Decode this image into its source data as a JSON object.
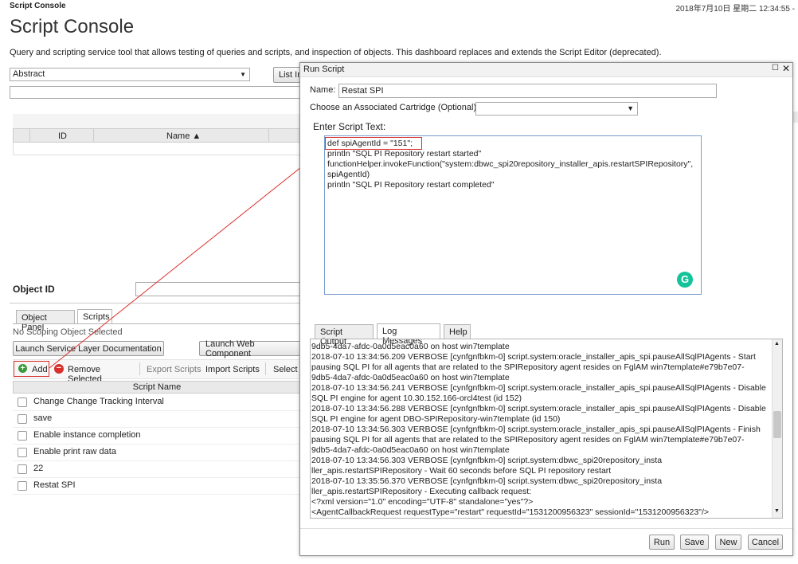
{
  "header": {
    "app_name": "Script Console",
    "datetime": "2018年7月10日 星期二 12:34:55 -",
    "page_title": "Script Console",
    "description": "Query and scripting service tool that allows testing of queries and scripts, and inspection of objects. This dashboard replaces and extends the Script Editor (deprecated)."
  },
  "query": {
    "type_select": "Abstract",
    "list_button": "List In"
  },
  "grid": {
    "col_id": "ID",
    "col_name": "Name ▲"
  },
  "object_id_label": "Object ID",
  "tabs": {
    "object_panel": "Object Panel",
    "scripts": "Scripts"
  },
  "no_scope": "No Scoping Object Selected",
  "buttons": {
    "launch_sl_doc": "Launch Service Layer Documentation",
    "launch_web": "Launch Web Component",
    "add": "Add",
    "remove": "Remove Selected",
    "export": "Export Scripts",
    "import": "Import Scripts",
    "select": "Select A"
  },
  "scripts": {
    "header": "Script Name",
    "items": [
      "Change Change Tracking Interval",
      "save",
      "Enable instance completion",
      "Enable print raw data",
      "22",
      "Restat SPI"
    ]
  },
  "dialog": {
    "title": "Run Script",
    "name_label": "Name:",
    "name_value": "Restat SPI",
    "cartridge_label": "Choose an Associated Cartridge (Optional):",
    "cartridge_value": "",
    "script_label": "Enter Script Text:",
    "script_lines": [
      "def spiAgentId = \"151\";",
      "println \"SQL PI Repository restart started\"",
      "functionHelper.invokeFunction(\"system:dbwc_spi20repository_installer_apis.restartSPIRepository\",",
      "spiAgentId)",
      "println \"SQL PI Repository restart completed\""
    ],
    "tabs": {
      "output": "Script Output",
      "log": "Log Messages",
      "help": "Help"
    },
    "log_lines": [
      "9db5-4da7-afdc-0a0d5eac0a60 on host win7template",
      "2018-07-10 13:34:56.209 VERBOSE [cynfgnfbkm-0] script.system:oracle_installer_apis_spi.pauseAllSqlPIAgents - Start",
      "pausing SQL PI for all agents that are related to the SPIRepository agent resides on FglAM win7template#e79b7e07-",
      "9db5-4da7-afdc-0a0d5eac0a60 on host win7template",
      "2018-07-10 13:34:56.241 VERBOSE [cynfgnfbkm-0] script.system:oracle_installer_apis_spi.pauseAllSqlPIAgents - Disable",
      "SQL PI engine for agent 10.30.152.166-orcl4test (id 152)",
      "2018-07-10 13:34:56.288 VERBOSE [cynfgnfbkm-0] script.system:oracle_installer_apis_spi.pauseAllSqlPIAgents - Disable",
      "SQL PI engine for agent DBO-SPIRepository-win7template (id 150)",
      "2018-07-10 13:34:56.303 VERBOSE [cynfgnfbkm-0] script.system:oracle_installer_apis_spi.pauseAllSqlPIAgents - Finish",
      "pausing SQL PI for all agents that are related to the SPIRepository agent resides on FglAM win7template#e79b7e07-",
      "9db5-4da7-afdc-0a0d5eac0a60 on host win7template",
      "2018-07-10 13:34:56.303 VERBOSE [cynfgnfbkm-0] script.system:dbwc_spi20repository_insta",
      "ller_apis.restartSPIRepository - Wait 60 seconds before SQL PI repository restart",
      "2018-07-10 13:35:56.370 VERBOSE [cynfgnfbkm-0] script.system:dbwc_spi20repository_insta",
      "ller_apis.restartSPIRepository - Executing callback request:",
      "<?xml version=\"1.0\" encoding=\"UTF-8\" standalone=\"yes\"?>",
      "<AgentCallbackRequest requestType=\"restart\" requestId=\"1531200956323\" sessionId=\"1531200956323\"/>"
    ],
    "buttons": {
      "run": "Run",
      "save": "Save",
      "new": "New",
      "cancel": "Cancel"
    }
  },
  "colors": {
    "highlight": "#d9302c",
    "grammarly": "#15c39a",
    "add_icon": "#3c9a3c",
    "remove_icon": "#d9302c"
  }
}
